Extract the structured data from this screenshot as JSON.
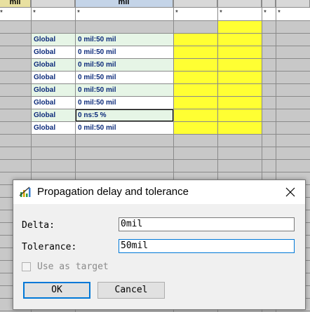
{
  "sheet": {
    "header_labels": [
      "mil",
      "mil"
    ],
    "star": "*",
    "rows": [
      {
        "scope": "Global",
        "value": "0 mil:50 mil"
      },
      {
        "scope": "Global",
        "value": "0 mil:50 mil"
      },
      {
        "scope": "Global",
        "value": "0 mil:50 mil"
      },
      {
        "scope": "Global",
        "value": "0 mil:50 mil"
      },
      {
        "scope": "Global",
        "value": "0 mil:50 mil"
      },
      {
        "scope": "Global",
        "value": "0 mil:50 mil"
      },
      {
        "scope": "Global",
        "value": "0 ns:5 %"
      },
      {
        "scope": "Global",
        "value": "0 mil:50 mil"
      }
    ],
    "highlight_color": "#ffff33",
    "row_tint_color": "#e6f5e6",
    "text_color": "#0b2a7a"
  },
  "dialog": {
    "title": "Propagation delay and tolerance",
    "icon": "app-icon",
    "close_icon": "close-icon",
    "delta_label": "Delta:",
    "delta_value": "0mil",
    "tolerance_label": "Tolerance:",
    "tolerance_value": "50mil",
    "use_as_target_label": "Use as target",
    "use_as_target_checked": false,
    "ok_label": "OK",
    "cancel_label": "Cancel",
    "accent_color": "#0078d7"
  }
}
